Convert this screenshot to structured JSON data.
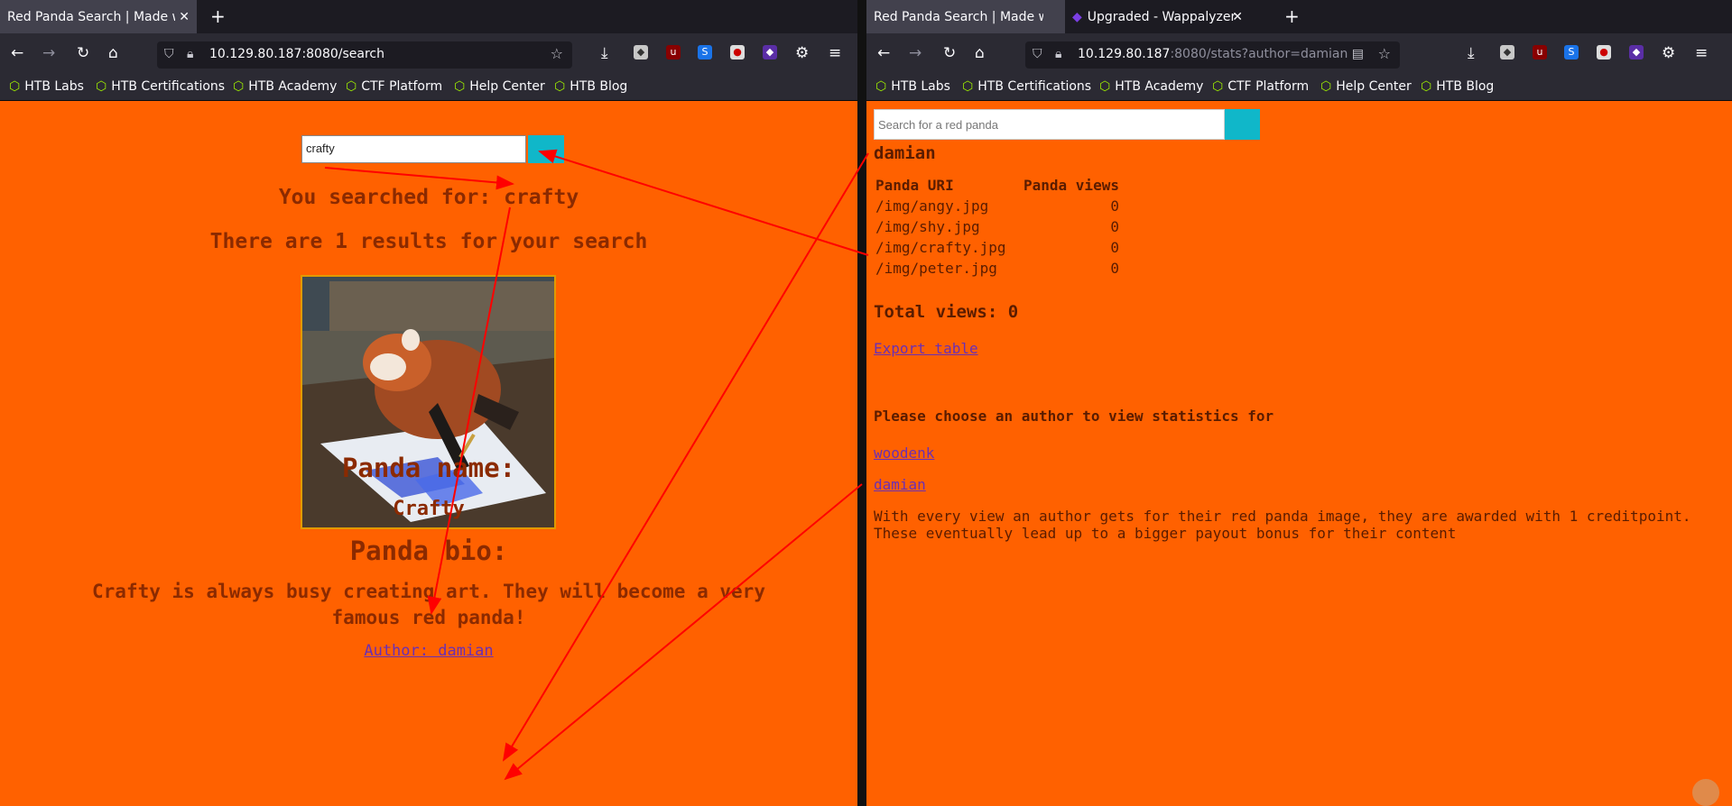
{
  "left": {
    "tab": {
      "title": "Red Panda Search | Made wit"
    },
    "url": {
      "host": "10.129.80.187",
      "rest": ":8080/search"
    },
    "bookmarks": [
      "HTB Labs",
      "HTB Certifications",
      "HTB Academy",
      "CTF Platform",
      "Help Center",
      "HTB Blog"
    ],
    "page": {
      "search_value": "crafty",
      "searched_for": "You searched for: crafty",
      "results": "There are 1 results for your search",
      "panda_name_heading": "Panda name:",
      "panda_name": "Crafty",
      "panda_bio_heading": "Panda bio:",
      "bio_line1": "Crafty is always busy creating art. They will become a very",
      "bio_line2": "famous red panda!",
      "author": "Author: damian"
    }
  },
  "right": {
    "tabs": [
      {
        "title": "Red Panda Search | Made wit"
      },
      {
        "title": "Upgraded - Wappalyzer"
      }
    ],
    "url": {
      "host": "10.129.80.187",
      "rest": ":8080/stats?author=damian"
    },
    "bookmarks": [
      "HTB Labs",
      "HTB Certifications",
      "HTB Academy",
      "CTF Platform",
      "Help Center",
      "HTB Blog"
    ],
    "page": {
      "search_placeholder": "Search for a red panda",
      "author_heading": "damian",
      "table_headers": [
        "Panda URI",
        "Panda views"
      ],
      "rows": [
        {
          "uri": "/img/angy.jpg",
          "views": "0"
        },
        {
          "uri": "/img/shy.jpg",
          "views": "0"
        },
        {
          "uri": "/img/crafty.jpg",
          "views": "0"
        },
        {
          "uri": "/img/peter.jpg",
          "views": "0"
        }
      ],
      "total": "Total views: 0",
      "export": "Export table",
      "choose": "Please choose an author to view statistics for",
      "authors": [
        "woodenk",
        "damian"
      ],
      "footer1": "With every view an author gets for their red panda image, they are awarded with 1 creditpoint.",
      "footer2": "These eventually lead up to a bigger payout bonus for their content"
    }
  },
  "colors": {
    "page_bg": "#ff6100",
    "search_button": "#10b7c9",
    "arrow": "#ff0000"
  }
}
